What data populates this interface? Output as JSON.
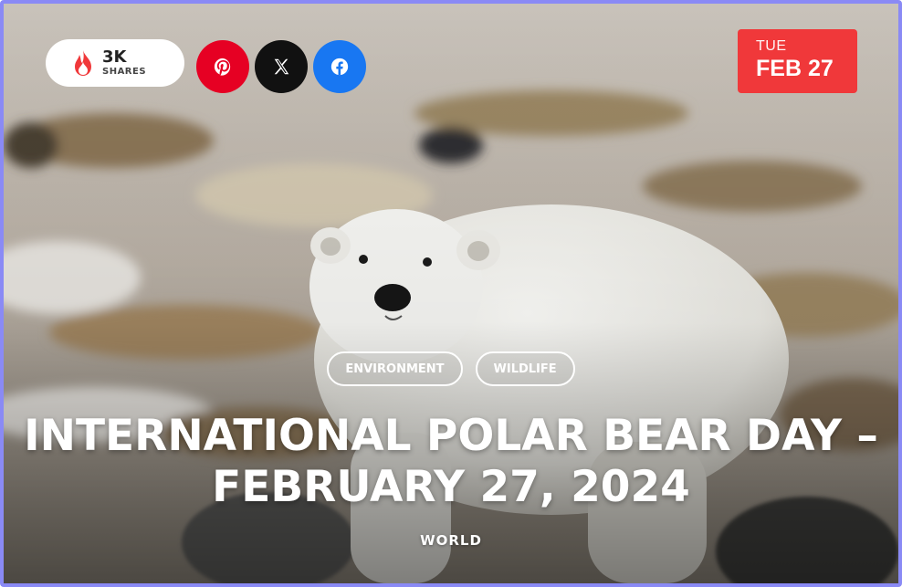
{
  "shares": {
    "count": "3K",
    "label": "SHARES",
    "icon": "flame-icon",
    "icon_color": "#f0383a"
  },
  "social": {
    "pinterest": {
      "icon": "pinterest-icon",
      "color": "#e60023"
    },
    "x": {
      "icon": "x-icon",
      "color": "#111111"
    },
    "facebook": {
      "icon": "facebook-icon",
      "color": "#1877f2"
    }
  },
  "date": {
    "day_of_week": "TUE",
    "month_day": "FEB 27",
    "color": "#f0383a"
  },
  "tags": [
    "ENVIRONMENT",
    "WILDLIFE"
  ],
  "title": "INTERNATIONAL POLAR BEAR DAY – FEBRUARY 27, 2024",
  "category": "WORLD"
}
